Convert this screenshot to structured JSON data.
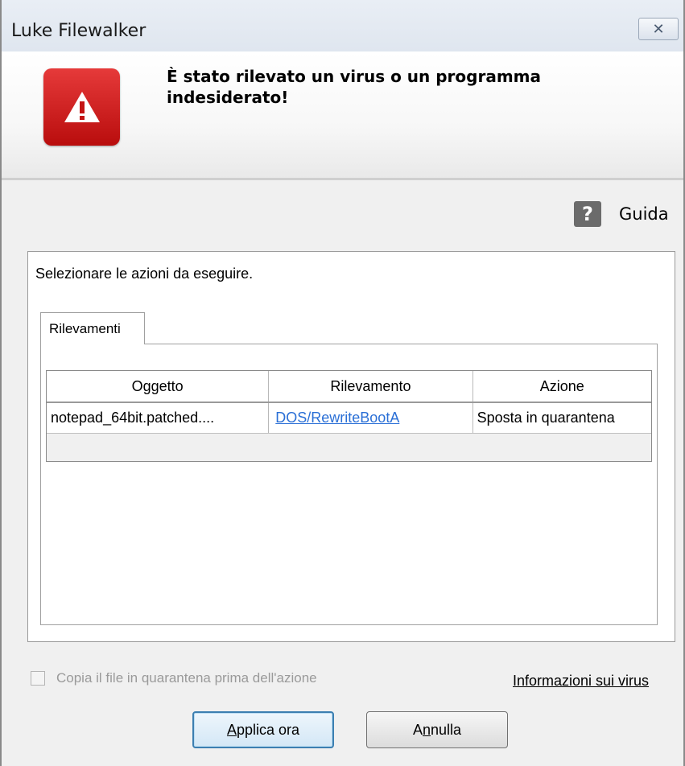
{
  "window": {
    "title": "Luke Filewalker",
    "close_glyph": "✕"
  },
  "header": {
    "heading": "È stato rilevato un virus o un programma indesiderato!",
    "icon": "warning-triangle-icon",
    "accent_color": "#d42020"
  },
  "help": {
    "icon_glyph": "?",
    "label": "Guida"
  },
  "main": {
    "instruction": "Selezionare le azioni da eseguire.",
    "tabs": [
      {
        "label": "Rilevamenti"
      }
    ],
    "table": {
      "columns": [
        "Oggetto",
        "Rilevamento",
        "Azione"
      ],
      "rows": [
        {
          "object": "notepad_64bit.patched....",
          "detection": "DOS/RewriteBootA",
          "action": "Sposta in quarantena"
        }
      ]
    }
  },
  "footer": {
    "checkbox_label": "Copia il file in quarantena prima dell'azione",
    "virus_info_link": "Informazioni sui virus",
    "apply_mnemonic": "A",
    "apply_rest": "pplica ora",
    "cancel_pre": "A",
    "cancel_mnemonic": "n",
    "cancel_rest": "nulla"
  }
}
